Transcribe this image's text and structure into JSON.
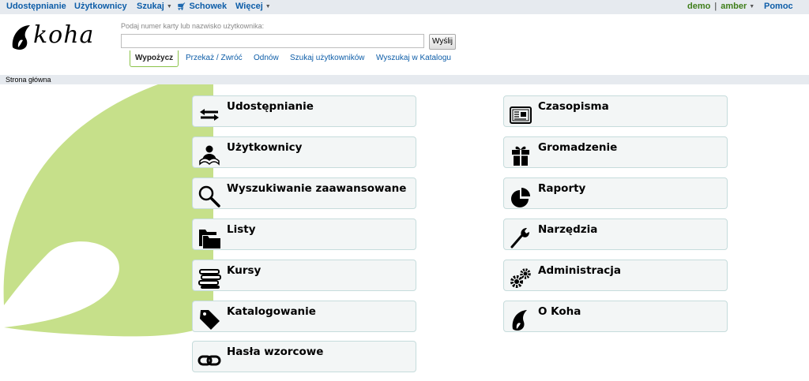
{
  "topnav": {
    "items": [
      {
        "label": "Udostępnianie"
      },
      {
        "label": "Użytkownicy"
      },
      {
        "label": "Szukaj",
        "has_caret": true
      },
      {
        "label": "Schowek",
        "icon": "cart-icon"
      },
      {
        "label": "Więcej",
        "has_caret": true
      }
    ],
    "user": "demo",
    "branch": "amber",
    "separator": "|",
    "help": "Pomoc"
  },
  "header": {
    "logo_text": "koha",
    "search_label": "Podaj numer karty lub nazwisko użytkownika:",
    "search_value": "",
    "search_button": "Wyślij",
    "tabs": [
      {
        "label": "Wypożycz",
        "active": true
      },
      {
        "label": "Przekaż / Zwróć"
      },
      {
        "label": "Odnów"
      },
      {
        "label": "Szukaj użytkowników"
      },
      {
        "label": "Wyszukaj w Katalogu"
      }
    ]
  },
  "breadcrumb": "Strona główna",
  "colors": {
    "nav_bg": "#e6eaef",
    "link": "#0d5da8",
    "user": "#3f7e1a",
    "accent_green": "#c6e08a",
    "tile_bg": "#f3f6f6",
    "tile_border": "#c6dcdc"
  },
  "modules": {
    "left": [
      {
        "label": "Udostępnianie",
        "icon": "circulation-arrows-icon"
      },
      {
        "label": "Użytkownicy",
        "icon": "patron-icon"
      },
      {
        "label": "Wyszukiwanie zaawansowane",
        "icon": "magnifier-icon"
      },
      {
        "label": "Listy",
        "icon": "folder-icon"
      },
      {
        "label": "Kursy",
        "icon": "books-stack-icon"
      },
      {
        "label": "Katalogowanie",
        "icon": "tag-icon"
      },
      {
        "label": "Hasła wzorcowe",
        "icon": "link-icon"
      }
    ],
    "right": [
      {
        "label": "Czasopisma",
        "icon": "newspaper-icon"
      },
      {
        "label": "Gromadzenie",
        "icon": "gift-icon"
      },
      {
        "label": "Raporty",
        "icon": "pie-chart-icon"
      },
      {
        "label": "Narzędzia",
        "icon": "wrench-icon"
      },
      {
        "label": "Administracja",
        "icon": "gears-icon"
      },
      {
        "label": "O Koha",
        "icon": "koha-leaf-icon"
      }
    ]
  }
}
